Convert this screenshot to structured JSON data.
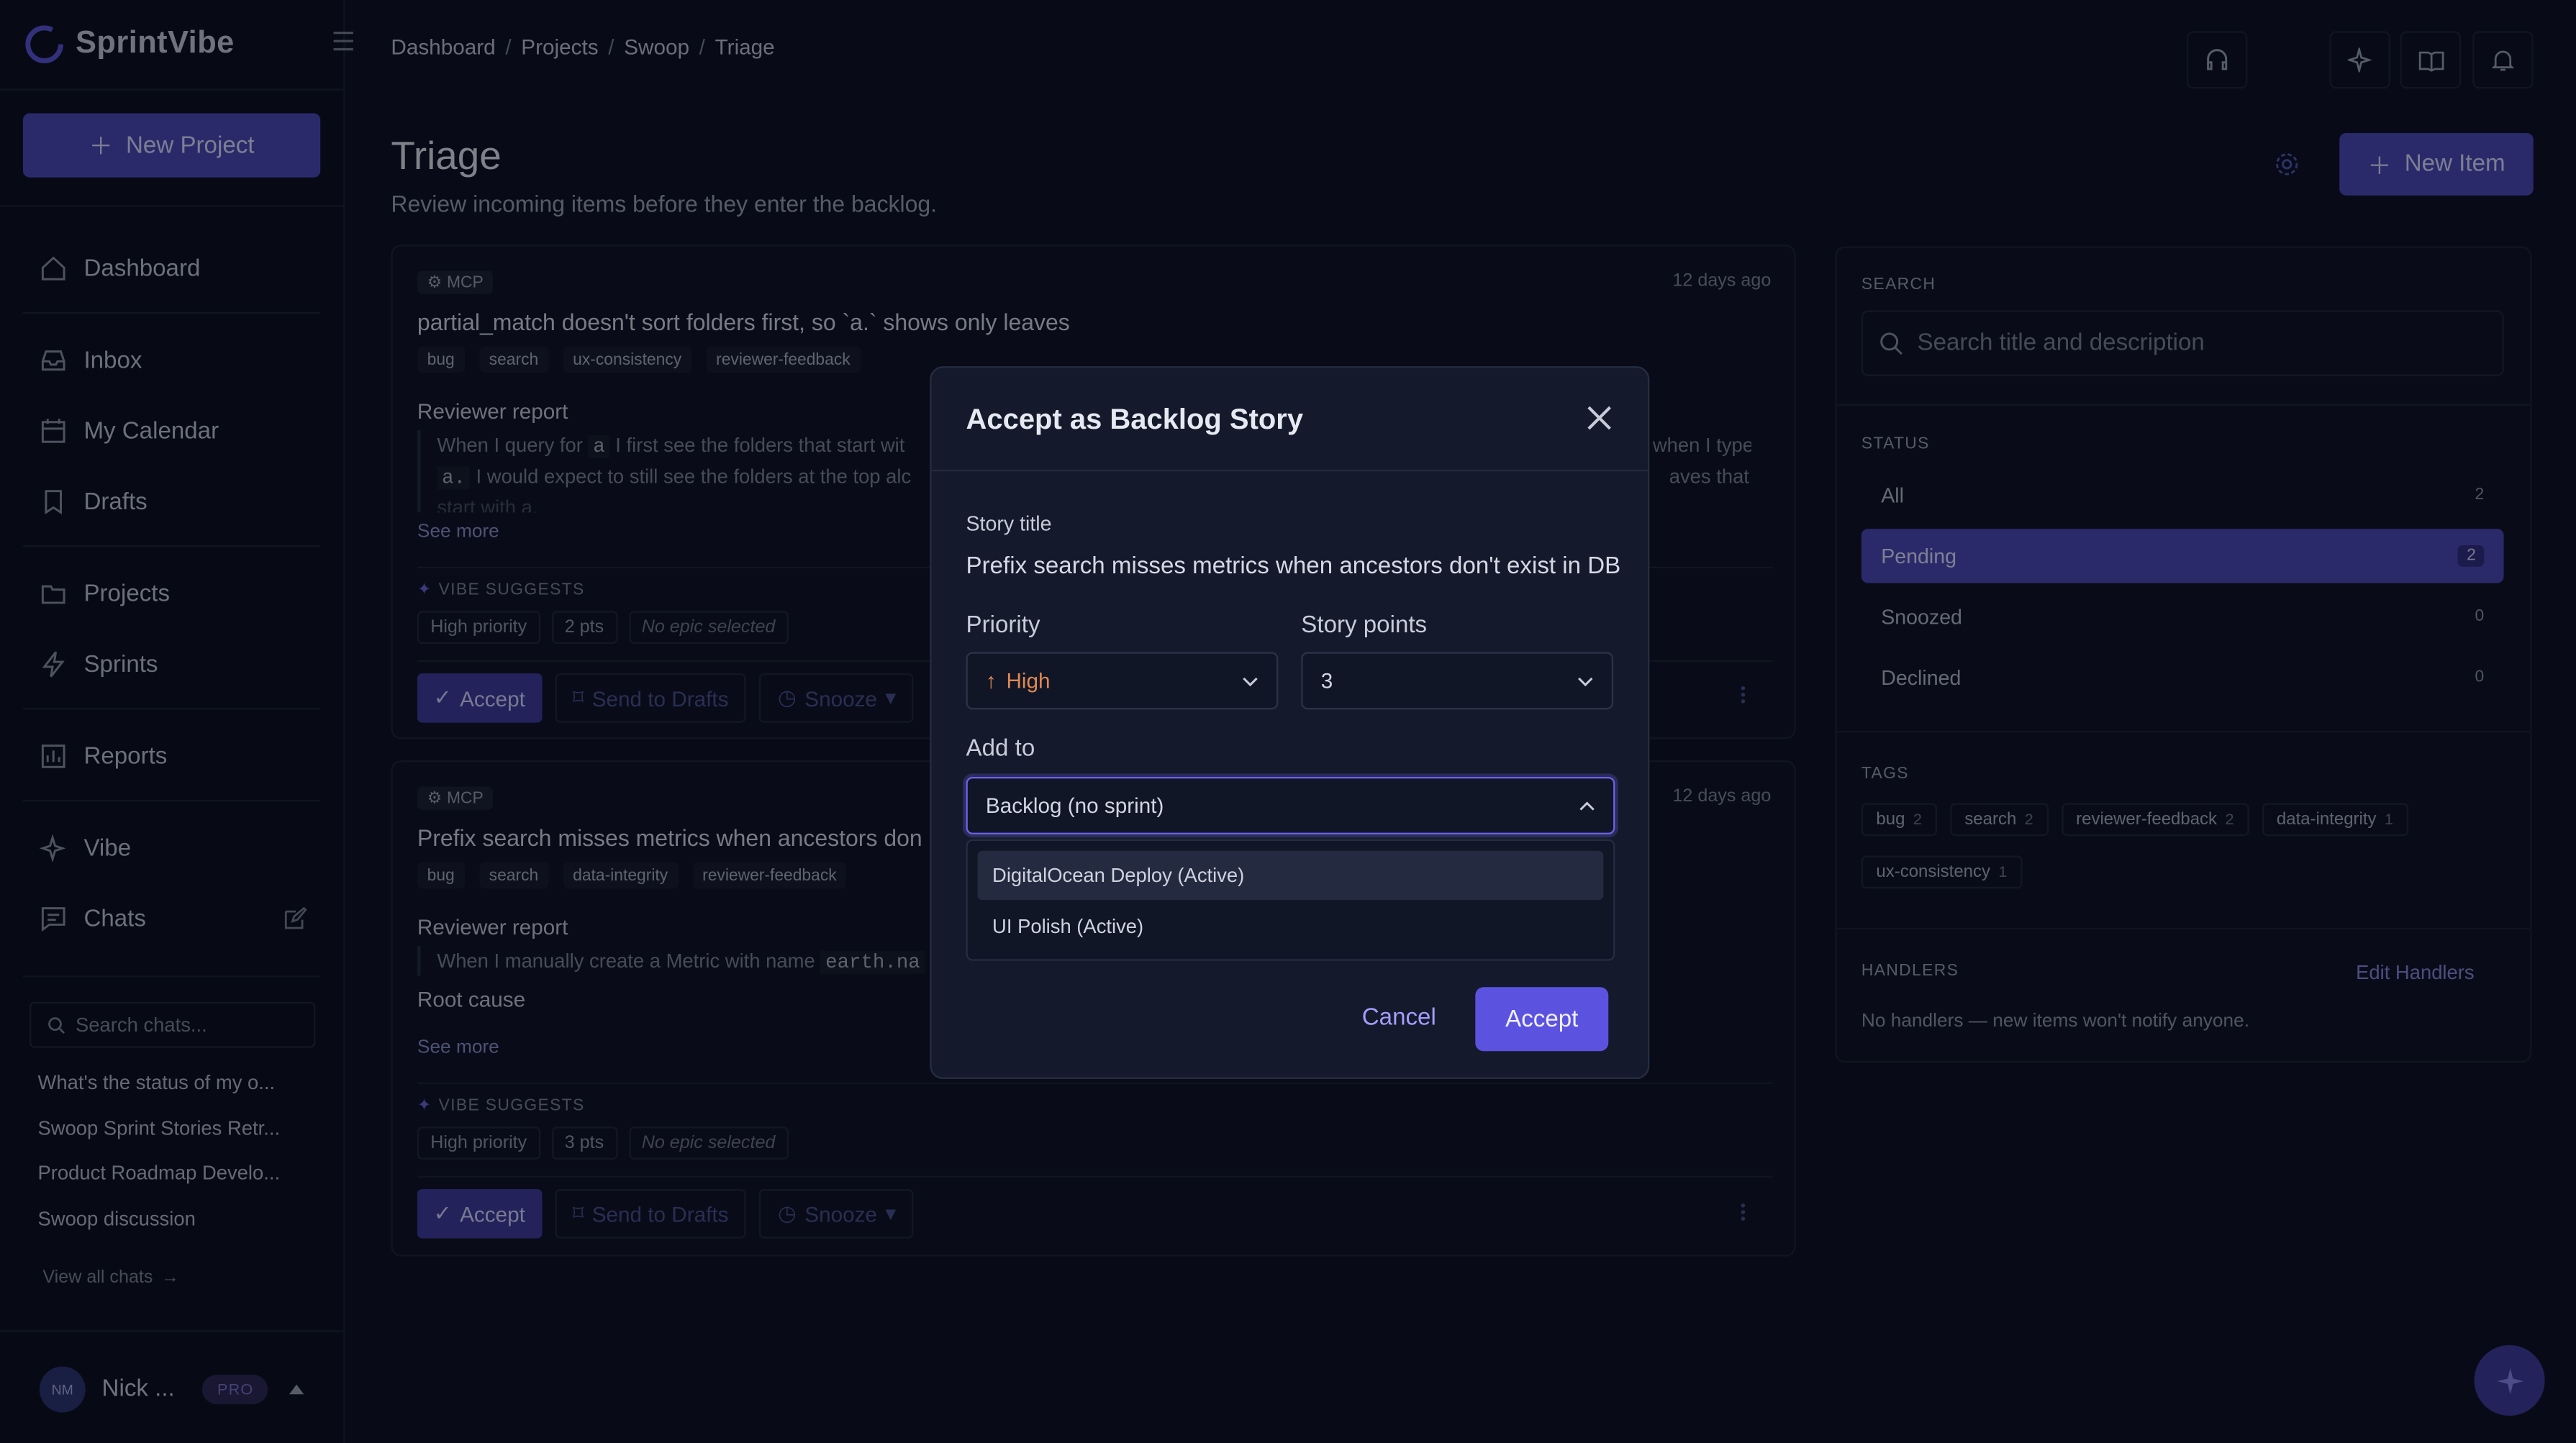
{
  "app": {
    "name": "SprintVibe"
  },
  "sidebar": {
    "new_project": "New Project",
    "nav": [
      {
        "label": "Dashboard",
        "icon": "home-icon"
      },
      {
        "label": "Inbox",
        "icon": "inbox-icon"
      },
      {
        "label": "My Calendar",
        "icon": "calendar-icon"
      },
      {
        "label": "Drafts",
        "icon": "bookmark-icon"
      },
      {
        "label": "Projects",
        "icon": "folder-icon"
      },
      {
        "label": "Sprints",
        "icon": "lightning-icon"
      },
      {
        "label": "Reports",
        "icon": "reports-icon"
      },
      {
        "label": "Vibe",
        "icon": "sparkle-icon"
      },
      {
        "label": "Chats",
        "icon": "chat-icon"
      }
    ],
    "chat_search_placeholder": "Search chats...",
    "chats": [
      "What's the status of my o...",
      "Swoop Sprint Stories Retr...",
      "Product Roadmap Develo...",
      "Swoop discussion"
    ],
    "view_all": "View all chats",
    "user": {
      "initials": "NM",
      "name": "Nick ...",
      "badge": "PRO"
    }
  },
  "breadcrumb": [
    "Dashboard",
    "Projects",
    "Swoop",
    "Triage"
  ],
  "page": {
    "title": "Triage",
    "subtitle": "Review incoming items before they enter the backlog.",
    "new_item": "New Item"
  },
  "cards": [
    {
      "source": "MCP",
      "ago": "12 days ago",
      "title": "partial_match doesn't sort folders first, so `a.` shows only leaves",
      "tags": [
        "bug",
        "search",
        "ux-consistency",
        "reviewer-feedback"
      ],
      "section": "Reviewer report",
      "line1_a": "When I query for",
      "line1_code": "a",
      "line1_b": "I first see the folders that start wit",
      "line1_right": "when I type",
      "line2_code": "a.",
      "line2_b": "I would expect to still see the folders at the top alc",
      "line2_right": "aves that",
      "line3": "start with  a.",
      "see_more": "See more",
      "vibe_label": "VIBE SUGGESTS",
      "suggest": [
        "High priority",
        "2 pts",
        "No epic selected"
      ],
      "accept": "Accept",
      "drafts": "Send to Drafts",
      "snooze": "Snooze"
    },
    {
      "source": "MCP",
      "ago": "12 days ago",
      "title": "Prefix search misses metrics when ancestors don",
      "tags": [
        "bug",
        "search",
        "data-integrity",
        "reviewer-feedback"
      ],
      "section": "Reviewer report",
      "line1_a": "When I manually create a Metric with name",
      "line1_code": "earth.na",
      "section2": "Root cause",
      "see_more": "See more",
      "vibe_label": "VIBE SUGGESTS",
      "suggest": [
        "High priority",
        "3 pts",
        "No epic selected"
      ],
      "accept": "Accept",
      "drafts": "Send to Drafts",
      "snooze": "Snooze"
    }
  ],
  "panel": {
    "search_label": "SEARCH",
    "search_placeholder": "Search title and description",
    "status_label": "STATUS",
    "statuses": [
      {
        "label": "All",
        "count": "2"
      },
      {
        "label": "Pending",
        "count": "2"
      },
      {
        "label": "Snoozed",
        "count": "0"
      },
      {
        "label": "Declined",
        "count": "0"
      }
    ],
    "tags_label": "TAGS",
    "tags": [
      {
        "label": "bug",
        "count": "2"
      },
      {
        "label": "search",
        "count": "2"
      },
      {
        "label": "reviewer-feedback",
        "count": "2"
      },
      {
        "label": "data-integrity",
        "count": "1"
      },
      {
        "label": "ux-consistency",
        "count": "1"
      }
    ],
    "handlers_label": "HANDLERS",
    "edit_handlers": "Edit Handlers",
    "no_handlers": "No handlers — new items won't notify anyone."
  },
  "modal": {
    "title": "Accept as Backlog Story",
    "story_title_label": "Story title",
    "story_title": "Prefix search misses metrics when ancestors don't exist in DB",
    "priority_label": "Priority",
    "priority_value": "High",
    "points_label": "Story points",
    "points_value": "3",
    "add_to_label": "Add to",
    "add_to_value": "Backlog (no sprint)",
    "options": [
      "DigitalOcean Deploy (Active)",
      "UI Polish (Active)"
    ],
    "cancel": "Cancel",
    "accept": "Accept"
  },
  "colors": {
    "accent": "#4a47b8",
    "priority_high": "#e08852",
    "background": "#0c1020"
  }
}
